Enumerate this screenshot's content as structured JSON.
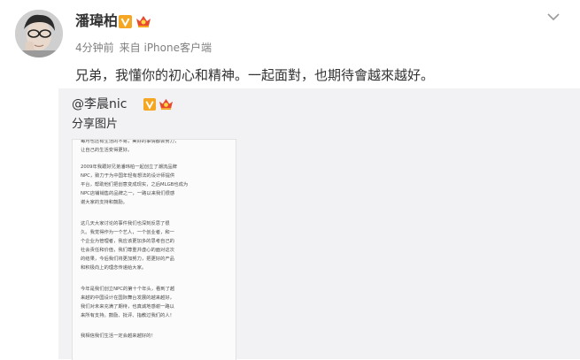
{
  "post": {
    "username": "潘瑋柏",
    "time": "4分钟前",
    "source_prefix": "来自",
    "source": "iPhone客户端",
    "text": "兄弟，我懂你的初心和精神。一起面對，也期待會越來越好。"
  },
  "repost": {
    "user": "@李晨nic",
    "share_label": "分享图片",
    "image_paragraphs": [
      [
        "每月也还有生活的不易，美好的事情都会努力，",
        "让自己的生活变得更好。"
      ],
      [
        "2009年我跟好兄弟潘玮柏一起创立了潮流品牌",
        "NPC，致力于为中国年轻有想法的设计师提供",
        "平台，帮助他们把创意变成现实，之后MLGB也成为",
        "NPC店铺销售的品牌之一，一路以来我们很感",
        "谢大家的支持和鼓励。"
      ],
      [
        "这几天大家讨论的事件我们也深刻反思了很",
        "久。我觉得作为一个艺人，一个创业者，和一",
        "个企业为管理者，我应该更加多的思考自己的",
        "社会责任和价值，我们尊重并虚心的面对这次",
        "的结果，今后我们将更加努力，把更好的产品",
        "和积极向上的理念传递给大家。"
      ],
      [
        "今年是我们创立NPC的第十个年头，看到了越",
        "来越的中国设计在国际舞台发展的越来越好，",
        "我们对未来充满了期待，也真诚地感谢一路以",
        "来所有支持。鼓励、批评、指教过我们的人！"
      ],
      [
        "我相信我们生活一定会越来越好的！"
      ]
    ]
  },
  "icons": {
    "verified": "verified-v-icon",
    "crown": "crown-icon",
    "menu": "chevron-down-icon"
  },
  "colors": {
    "badge_orange": "#f5a623",
    "crown_red": "#e8492d",
    "repost_bg": "#f2f2f5",
    "meta_gray": "#808080"
  }
}
